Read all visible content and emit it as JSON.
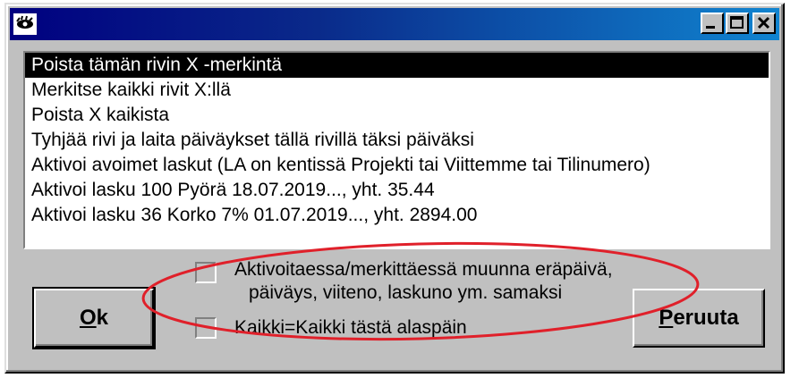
{
  "window": {
    "title": "",
    "controls": {
      "minimize_icon": "minimize-icon",
      "maximize_icon": "maximize-icon",
      "close_icon": "close-icon"
    }
  },
  "list": {
    "items": [
      {
        "label": "Poista tämän rivin X -merkintä",
        "selected": true
      },
      {
        "label": "Merkitse kaikki rivit X:llä",
        "selected": false
      },
      {
        "label": "Poista X kaikista",
        "selected": false
      },
      {
        "label": "Tyhjää rivi ja laita päiväykset tällä rivillä täksi päiväksi",
        "selected": false
      },
      {
        "label": "Aktivoi avoimet laskut (LA on kentissä Projekti tai Viittemme tai Tilinumero)",
        "selected": false
      },
      {
        "label": "Aktivoi lasku 100 Pyörä 18.07.2019..., yht. 35.44",
        "selected": false
      },
      {
        "label": "Aktivoi lasku 36 Korko 7% 01.07.2019..., yht. 2894.00",
        "selected": false
      }
    ]
  },
  "options": {
    "convert": {
      "line1": "Aktivoitaessa/merkittäessä muunna eräpäivä,",
      "line2": "päiväys, viiteno, laskuno ym. samaksi",
      "checked": false
    },
    "all_below": {
      "label": "Kaikki=Kaikki tästä alaspäin",
      "checked": false
    }
  },
  "buttons": {
    "ok": {
      "mnemonic": "O",
      "rest": "k"
    },
    "cancel": {
      "mnemonic": "P",
      "rest": "eruuta"
    }
  },
  "colors": {
    "annotation": "#e0202a",
    "titlebar_start": "#000080",
    "titlebar_end": "#1084d0",
    "face": "#c0c0c0"
  }
}
